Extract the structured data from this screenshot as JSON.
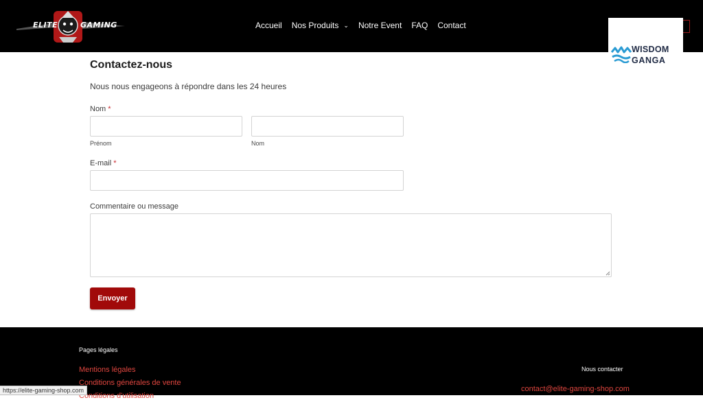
{
  "header": {
    "logo_text_left": "ELITE",
    "logo_text_right": "GAMING",
    "nav": [
      {
        "label": "Accueil"
      },
      {
        "label": "Nos Produits"
      },
      {
        "label": "Notre Event"
      },
      {
        "label": "FAQ"
      },
      {
        "label": "Contact"
      }
    ]
  },
  "watermark": {
    "line1": "WISDOM",
    "line2": "GANGA"
  },
  "form": {
    "title": "Contactez-nous",
    "subtitle": "Nous nous engageons à répondre dans les 24 heures",
    "name_label": "Nom",
    "required_mark": "*",
    "first_name_value": "",
    "first_name_caption": "Prénom",
    "last_name_value": "",
    "last_name_caption": "Nom",
    "email_label": "E-mail",
    "email_value": "",
    "message_label": "Commentaire ou message",
    "message_value": "",
    "submit_label": "Envoyer"
  },
  "footer": {
    "legal_heading": "Pages légales",
    "legal_links": [
      "Mentions légales",
      "Conditions générales de vente",
      "Conditions d'utilisation"
    ],
    "contact_heading": "Nous contacter",
    "contact_email": "contact@elite-gaming-shop.com"
  },
  "status_bar": {
    "url": "https://elite-gaming-shop.com"
  },
  "colors": {
    "accent": "#a10a0a",
    "link": "#e0463f",
    "header_bg": "#000000"
  }
}
